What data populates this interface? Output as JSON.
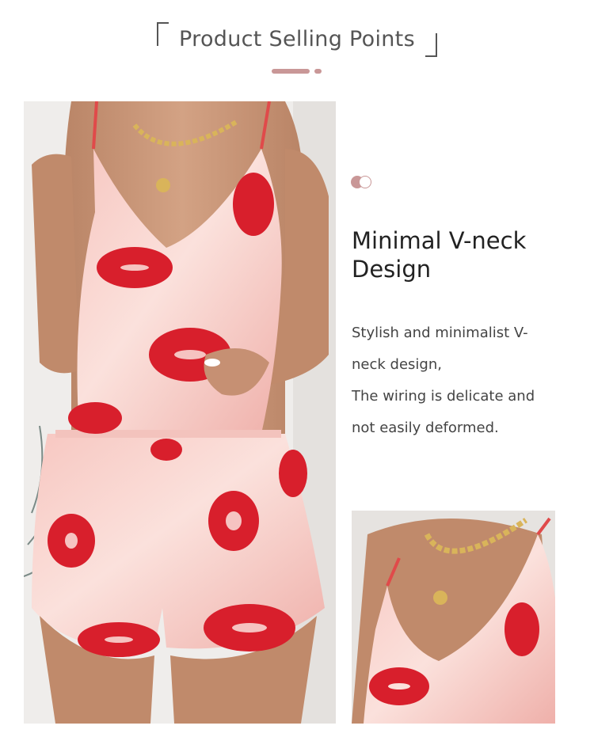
{
  "header": {
    "title": "Product Selling Points"
  },
  "feature": {
    "title": "Minimal V-neck\nDesign",
    "description_lines": [
      "Stylish and minimalist V-",
      "neck design,",
      "The wiring is delicate and",
      "not easily deformed."
    ]
  },
  "colors": {
    "accent": "#c99797",
    "garment": "#f2b9b4",
    "print": "#d81f2c"
  }
}
